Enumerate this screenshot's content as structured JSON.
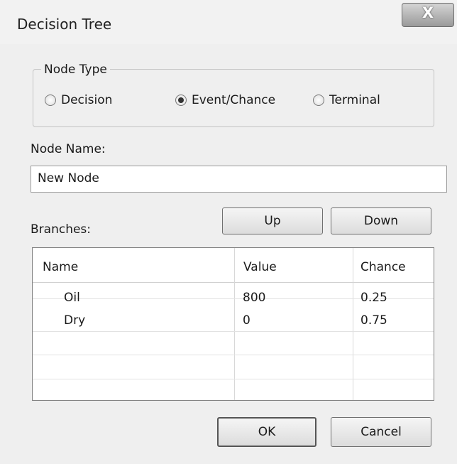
{
  "window": {
    "title": "Decision Tree",
    "close_label": "X"
  },
  "node_type": {
    "group_label": "Node Type",
    "options": [
      {
        "label": "Decision",
        "checked": false
      },
      {
        "label": "Event/Chance",
        "checked": true
      },
      {
        "label": "Terminal",
        "checked": false
      }
    ]
  },
  "node_name": {
    "label": "Node Name:",
    "value": "New Node"
  },
  "branches": {
    "label": "Branches:",
    "up_label": "Up",
    "down_label": "Down",
    "columns": [
      "Name",
      "Value",
      "Chance"
    ],
    "rows": [
      {
        "name": "Oil",
        "value": "800",
        "chance": "0.25"
      },
      {
        "name": "Dry",
        "value": "0",
        "chance": "0.75"
      }
    ]
  },
  "footer": {
    "ok_label": "OK",
    "cancel_label": "Cancel"
  },
  "icons": [
    "close-icon",
    "radio-icon"
  ]
}
